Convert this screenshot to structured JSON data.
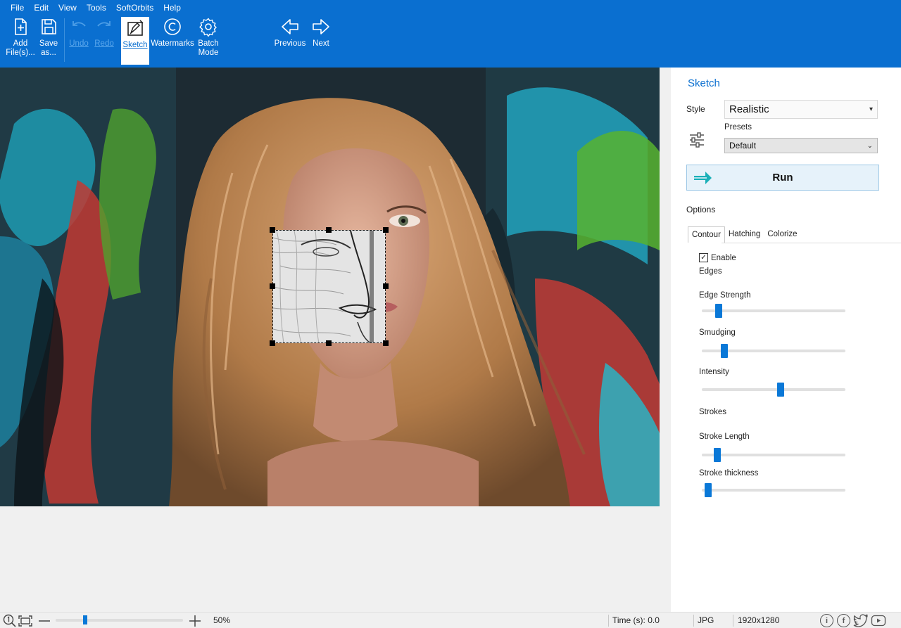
{
  "menu": [
    {
      "label": "File"
    },
    {
      "label": "Edit"
    },
    {
      "label": "View"
    },
    {
      "label": "Tools"
    },
    {
      "label": "SoftOrbits"
    },
    {
      "label": "Help"
    }
  ],
  "toolbar": {
    "add_files": {
      "line1": "Add",
      "line2": "File(s)...",
      "icon": "add-file-icon"
    },
    "save_as": {
      "line1": "Save",
      "line2": "as...",
      "icon": "save-icon"
    },
    "undo": {
      "label": "Undo",
      "icon": "undo-icon"
    },
    "redo": {
      "label": "Redo",
      "icon": "redo-icon"
    },
    "sketch": {
      "label": "Sketch",
      "icon": "sketch-icon"
    },
    "watermarks": {
      "label": "Watermarks",
      "icon": "copyright-icon"
    },
    "batch_mode": {
      "line1": "Batch",
      "line2": "Mode",
      "icon": "gear-icon"
    },
    "previous": {
      "label": "Previous",
      "icon": "arrow-left-icon"
    },
    "next": {
      "label": "Next",
      "icon": "arrow-right-icon"
    }
  },
  "panel": {
    "title": "Sketch",
    "style_label": "Style",
    "style_value": "Realistic",
    "presets_label": "Presets",
    "presets_value": "Default",
    "run_label": "Run",
    "options_label": "Options",
    "tabs": [
      {
        "label": "Contour",
        "active": true
      },
      {
        "label": "Hatching",
        "active": false
      },
      {
        "label": "Colorize",
        "active": false
      }
    ],
    "enable_label": "Enable",
    "enable_checked": true,
    "edges_label": "Edges",
    "strokes_label": "Strokes",
    "sliders": {
      "edge_strength": {
        "label": "Edge Strength",
        "value": 0.1
      },
      "smudging": {
        "label": "Smudging",
        "value": 0.14
      },
      "intensity": {
        "label": "Intensity",
        "value": 0.55
      },
      "stroke_length": {
        "label": "Stroke Length",
        "value": 0.09
      },
      "stroke_thickness": {
        "label": "Stroke thickness",
        "value": 0.02
      }
    }
  },
  "statusbar": {
    "zoom": "50%",
    "time": "Time (s): 0.0",
    "format": "JPG",
    "dimensions": "1920x1280"
  },
  "colors": {
    "ribbon": "#0a6fd0",
    "accent": "#0a78d7"
  }
}
